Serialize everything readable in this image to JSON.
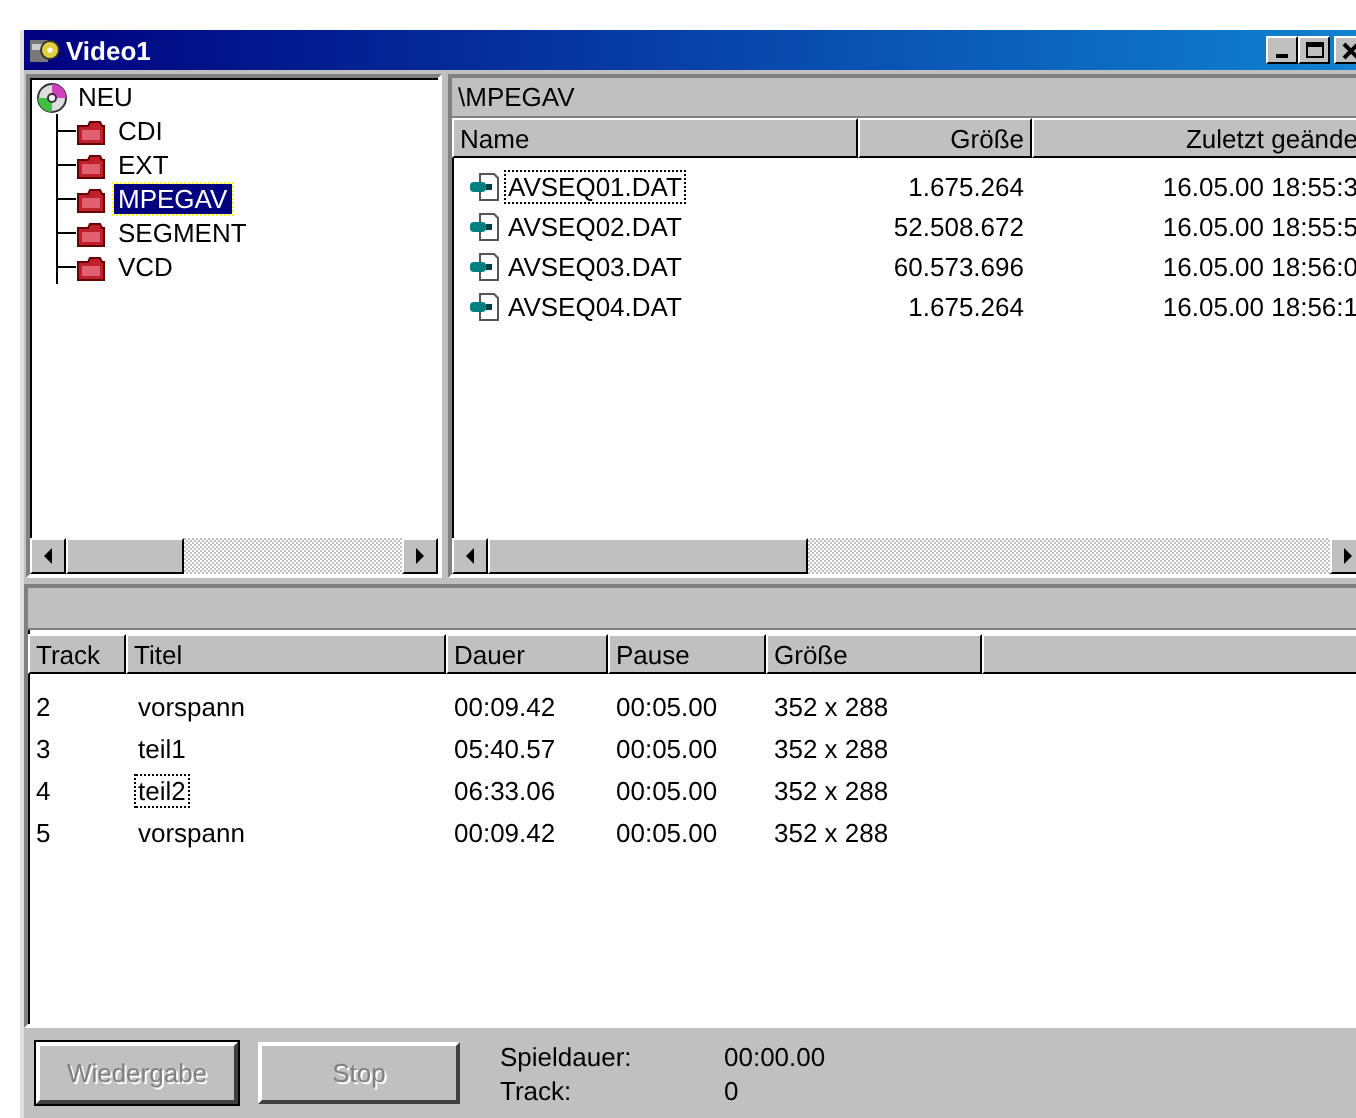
{
  "window": {
    "title": "Video1"
  },
  "tree": {
    "label": "NEU",
    "children": [
      {
        "label": "CDI",
        "selected": false
      },
      {
        "label": "EXT",
        "selected": false
      },
      {
        "label": "MPEGAV",
        "selected": true
      },
      {
        "label": "SEGMENT",
        "selected": false
      },
      {
        "label": "VCD",
        "selected": false
      }
    ]
  },
  "file_list": {
    "path": "\\MPEGAV",
    "columns": [
      "Name",
      "Größe",
      "Zuletzt geände"
    ],
    "rows": [
      {
        "name": "AVSEQ01.DAT",
        "size": "1.675.264",
        "modified": "16.05.00 18:55:3",
        "focused": true
      },
      {
        "name": "AVSEQ02.DAT",
        "size": "52.508.672",
        "modified": "16.05.00 18:55:5",
        "focused": false
      },
      {
        "name": "AVSEQ03.DAT",
        "size": "60.573.696",
        "modified": "16.05.00 18:56:0",
        "focused": false
      },
      {
        "name": "AVSEQ04.DAT",
        "size": "1.675.264",
        "modified": "16.05.00 18:56:1",
        "focused": false
      }
    ]
  },
  "track_list": {
    "columns": [
      "Track",
      "Titel",
      "Dauer",
      "Pause",
      "Größe"
    ],
    "rows": [
      {
        "track": "2",
        "title": "vorspann",
        "duration": "00:09.42",
        "pause": "00:05.00",
        "size": "352 x 288",
        "focused": false
      },
      {
        "track": "3",
        "title": "teil1",
        "duration": "05:40.57",
        "pause": "00:05.00",
        "size": "352 x 288",
        "focused": false
      },
      {
        "track": "4",
        "title": "teil2",
        "duration": "06:33.06",
        "pause": "00:05.00",
        "size": "352 x 288",
        "focused": true
      },
      {
        "track": "5",
        "title": "vorspann",
        "duration": "00:09.42",
        "pause": "00:05.00",
        "size": "352 x 288",
        "focused": false
      }
    ]
  },
  "buttons": [
    {
      "label": "Wiedergabe",
      "disabled": true,
      "default": true
    },
    {
      "label": "Stop",
      "disabled": true,
      "default": false
    }
  ],
  "status": [
    {
      "label": "Spieldauer:",
      "value": "00:00.00"
    },
    {
      "label": "Track:",
      "value": "0"
    }
  ]
}
